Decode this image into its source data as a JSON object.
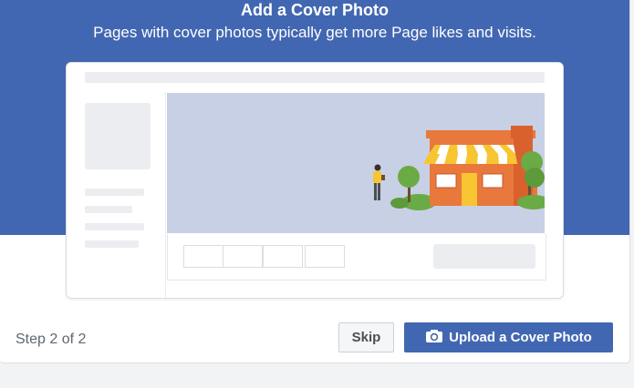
{
  "header": {
    "title": "Add a Cover Photo",
    "subtitle": "Pages with cover photos typically get more Page likes and visits."
  },
  "illustration": {
    "icons": [
      "page-mockup",
      "shop-illustration",
      "person-illustration",
      "tree-icon",
      "bush-icon"
    ]
  },
  "footer": {
    "step_text": "Step 2 of 2",
    "skip_label": "Skip",
    "upload_label": "Upload a Cover Photo",
    "upload_icon": "camera-icon"
  },
  "colors": {
    "brand_blue": "#4267b2",
    "cover_placeholder": "#c8d0e5",
    "shop_orange": "#e8783c",
    "awning_yellow": "#f7c531",
    "tree_green": "#6aab45"
  }
}
